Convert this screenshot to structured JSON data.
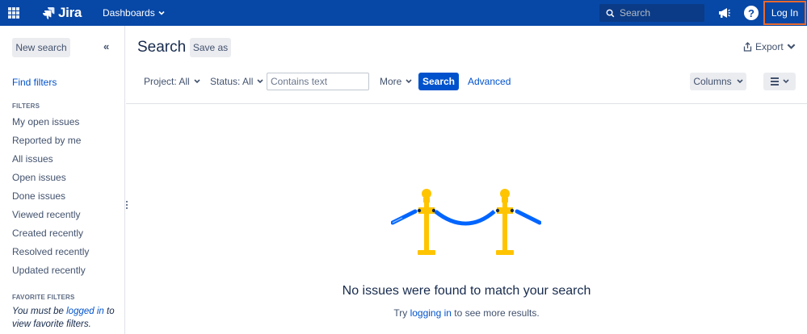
{
  "topbar": {
    "logo_text": "Jira",
    "dashboards_label": "Dashboards",
    "search_placeholder": "Search",
    "help_glyph": "?",
    "login_label": "Log In"
  },
  "sidebar": {
    "new_search_label": "New search",
    "collapse_glyph": "«",
    "find_filters_label": "Find filters",
    "filters_heading": "FILTERS",
    "filters": [
      "My open issues",
      "Reported by me",
      "All issues",
      "Open issues",
      "Done issues",
      "Viewed recently",
      "Created recently",
      "Resolved recently",
      "Updated recently"
    ],
    "favorite_heading": "FAVORITE FILTERS",
    "favorite_note_pre": "You must be ",
    "favorite_note_link": "logged in",
    "favorite_note_post": " to view favorite filters."
  },
  "main": {
    "title": "Search",
    "save_as_label": "Save as",
    "export_label": "Export",
    "project_filter": "Project: All",
    "status_filter": "Status: All",
    "text_placeholder": "Contains text",
    "more_label": "More",
    "search_button": "Search",
    "advanced_link": "Advanced",
    "columns_label": "Columns",
    "empty_title": "No issues were found to match your search",
    "empty_sub_pre": "Try ",
    "empty_sub_link": "logging in",
    "empty_sub_post": " to see more results."
  },
  "colors": {
    "topbar": "#0747a6",
    "primary": "#0052cc",
    "login_outline": "#e86a2e",
    "illustration_gold": "#ffc400",
    "illustration_rope": "#0065ff"
  },
  "icons": [
    "app-switcher-icon",
    "jira-logo-icon",
    "search-icon",
    "megaphone-icon",
    "help-icon",
    "export-icon",
    "chevron-down-icon",
    "list-view-icon"
  ]
}
